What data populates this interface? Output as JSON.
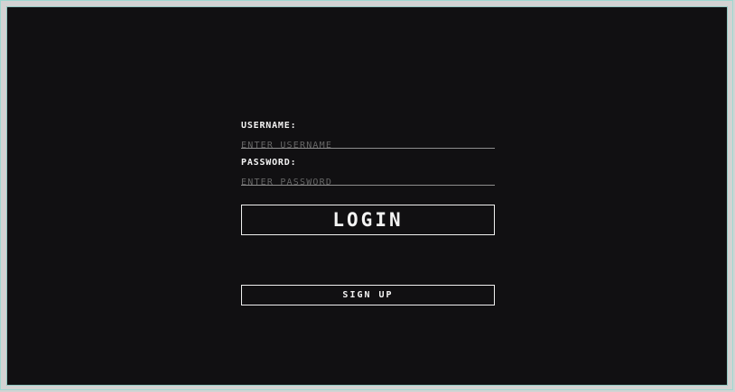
{
  "login_form": {
    "username_label": "USERNAME:",
    "username_placeholder": "ENTER USERNAME",
    "username_value": "",
    "password_label": "PASSWORD:",
    "password_placeholder": "ENTER PASSWORD",
    "password_value": "",
    "login_button_label": "LOGIN",
    "signup_button_label": "SIGN UP"
  },
  "colors": {
    "background": "#111012",
    "text": "#f2f2f2",
    "placeholder": "#666666",
    "border": "#f0f0f0",
    "frame": "#d3d3d3"
  }
}
